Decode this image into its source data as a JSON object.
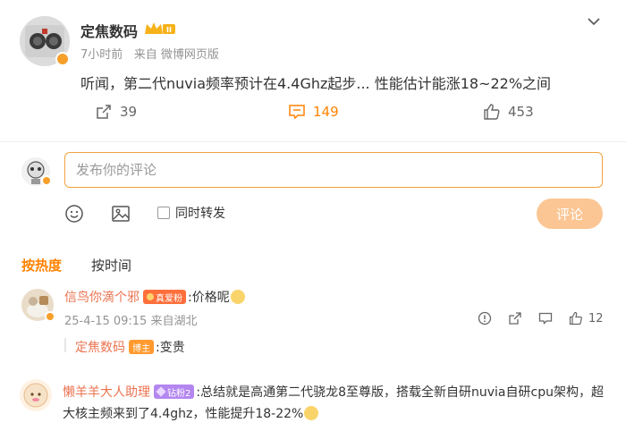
{
  "post": {
    "author": "定焦数码",
    "time": "7小时前",
    "source": "来自 微博网页版",
    "text": "听闻，第二代nuvia频率预计在4.4Ghz起步... 性能估计能涨18~22%之间",
    "reposts": "39",
    "comments": "149",
    "likes": "453"
  },
  "composer": {
    "placeholder": "发布你的评论",
    "also_repost": "同时转发",
    "submit": "评论"
  },
  "sort": {
    "hot": "按热度",
    "time": "按时间"
  },
  "comments": [
    {
      "user": "信鸟你滴个邪",
      "tag": "真爱粉",
      "text": ":价格呢",
      "date": "25-4-15 09:15",
      "location": "来自湖北",
      "likes": "12",
      "reply": {
        "user": "定焦数码",
        "tag": "博主",
        "text": ":变贵"
      }
    },
    {
      "user": "懒羊羊大人助理",
      "tag": "钻粉2",
      "text_line1": ":总结就是高通第二代骁龙8至尊版，搭载全新自研nuvia自研cpu架构，超",
      "text_line2": "大核主频来到了4.4ghz，性能提升18-22%"
    }
  ],
  "colors": {
    "accent": "#ff8200",
    "username": "#eb7350",
    "submit_disabled": "#fbc694",
    "input_border": "#f2a23e"
  }
}
